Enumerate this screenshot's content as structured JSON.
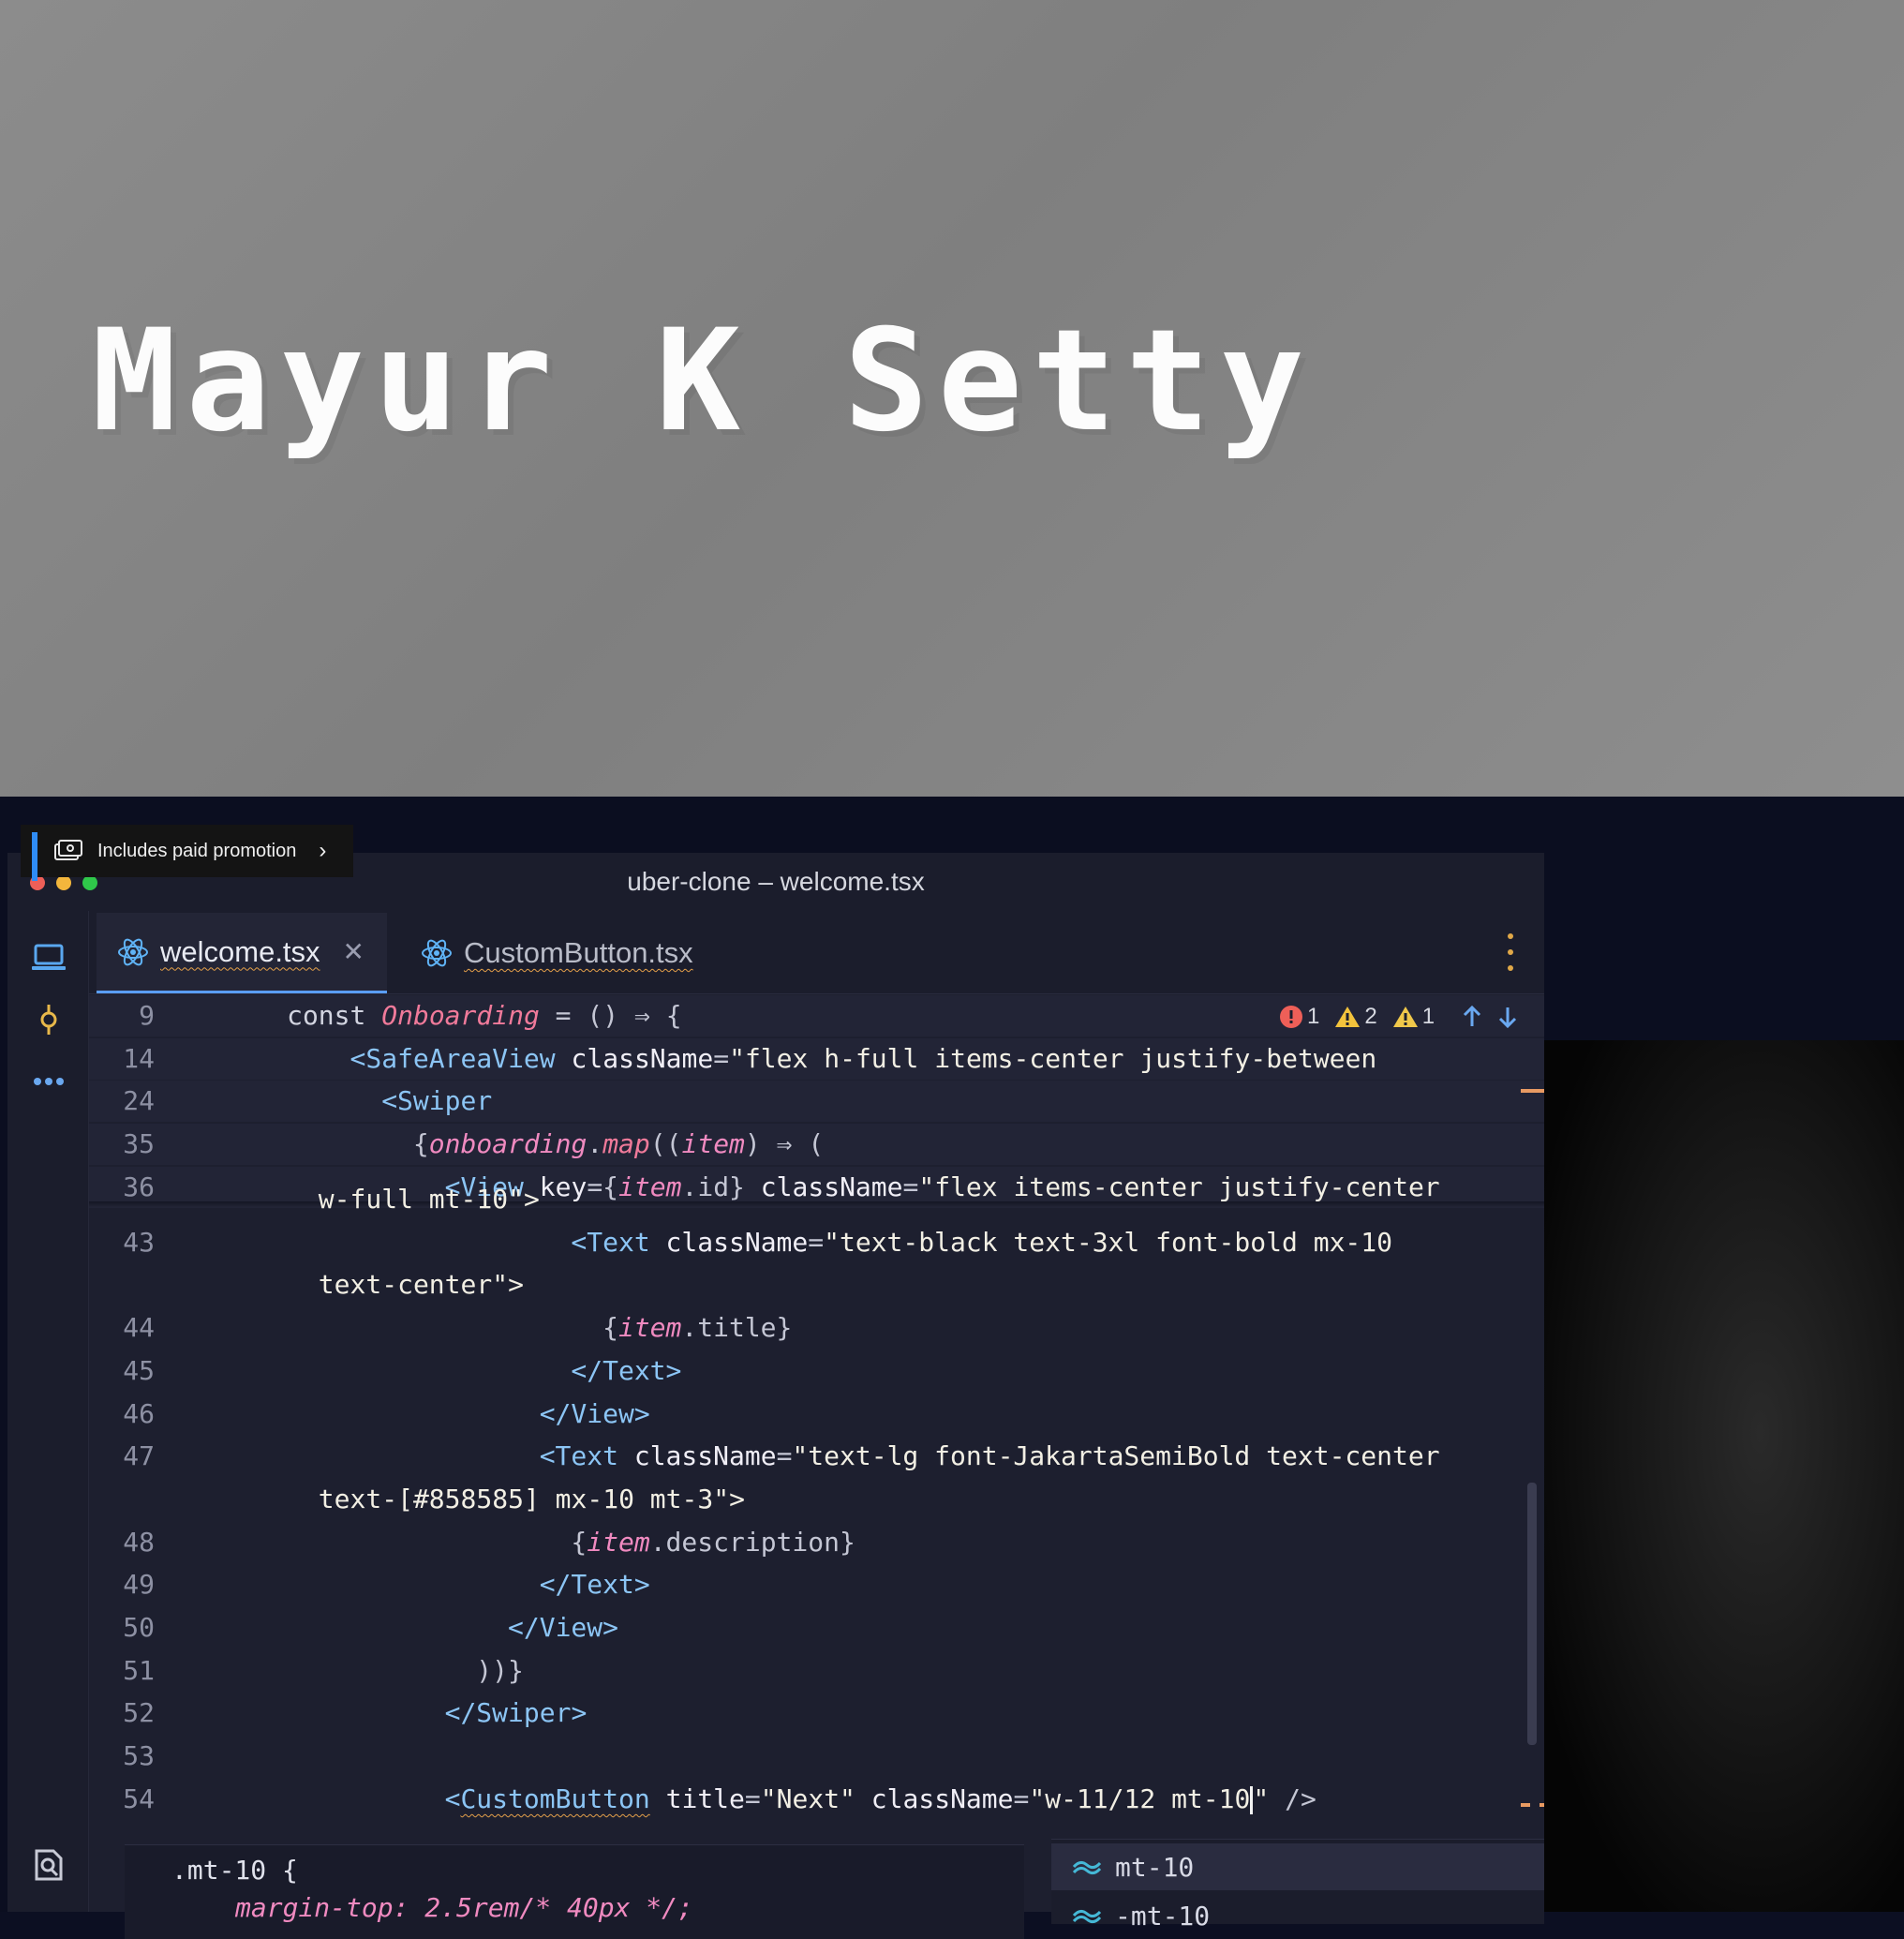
{
  "banner": {
    "title": "Mayur K Setty"
  },
  "promo": {
    "label": "Includes paid promotion"
  },
  "window": {
    "title": "uber-clone – welcome.tsx"
  },
  "tabs": [
    {
      "label": "welcome.tsx",
      "active": true
    },
    {
      "label": "CustomButton.tsx",
      "active": false
    }
  ],
  "status": {
    "errors": "1",
    "warnings": "2",
    "weak_warnings": "1"
  },
  "editor": {
    "sticky": [
      {
        "ln": "9",
        "indent": 3,
        "parts": [
          [
            "kw",
            "const "
          ],
          [
            "fn",
            "Onboarding"
          ],
          [
            "punc",
            " = () ⇒ {"
          ]
        ]
      },
      {
        "ln": "14",
        "indent": 5,
        "parts": [
          [
            "tag",
            "<SafeAreaView"
          ],
          [
            "attr",
            " className"
          ],
          [
            "punc",
            "="
          ],
          [
            "str",
            "\"flex h-full items-center justify-between"
          ]
        ]
      },
      {
        "ln": "24",
        "indent": 6,
        "parts": [
          [
            "tag",
            "<Swiper"
          ]
        ]
      },
      {
        "ln": "35",
        "indent": 7,
        "parts": [
          [
            "punc",
            "{"
          ],
          [
            "var",
            "onboarding"
          ],
          [
            "punc",
            "."
          ],
          [
            "fn",
            "map"
          ],
          [
            "punc",
            "(("
          ],
          [
            "var",
            "item"
          ],
          [
            "punc",
            ") ⇒ ("
          ]
        ]
      },
      {
        "ln": "36",
        "indent": 8,
        "parts": [
          [
            "tag",
            "<View"
          ],
          [
            "attr",
            " key"
          ],
          [
            "punc",
            "={"
          ],
          [
            "var",
            "item"
          ],
          [
            "punc",
            ".id}"
          ],
          [
            "attr",
            " className"
          ],
          [
            "punc",
            "="
          ],
          [
            "str",
            "\"flex items-center justify-center"
          ]
        ]
      }
    ],
    "lines": [
      {
        "ln": "",
        "indent": 4,
        "parts": [
          [
            "str",
            "w-full mt-10\">"
          ]
        ]
      },
      {
        "ln": "43",
        "indent": 12,
        "parts": [
          [
            "tag",
            "<Text"
          ],
          [
            "attr",
            " className"
          ],
          [
            "punc",
            "="
          ],
          [
            "str",
            "\"text-black text-3xl font-bold mx-10"
          ]
        ]
      },
      {
        "ln": "",
        "indent": 4,
        "parts": [
          [
            "str",
            "text-center\">"
          ]
        ]
      },
      {
        "ln": "44",
        "indent": 13,
        "parts": [
          [
            "punc",
            "{"
          ],
          [
            "var",
            "item"
          ],
          [
            "punc",
            ".title}"
          ]
        ]
      },
      {
        "ln": "45",
        "indent": 12,
        "parts": [
          [
            "tag",
            "</Text>"
          ]
        ]
      },
      {
        "ln": "46",
        "indent": 11,
        "parts": [
          [
            "tag",
            "</View>"
          ]
        ]
      },
      {
        "ln": "47",
        "indent": 11,
        "parts": [
          [
            "tag",
            "<Text"
          ],
          [
            "attr",
            " className"
          ],
          [
            "punc",
            "="
          ],
          [
            "str",
            "\"text-lg font-JakartaSemiBold text-center"
          ]
        ]
      },
      {
        "ln": "",
        "indent": 4,
        "parts": [
          [
            "str",
            "text-[#858585] mx-10 mt-3\">"
          ]
        ]
      },
      {
        "ln": "48",
        "indent": 12,
        "parts": [
          [
            "punc",
            "{"
          ],
          [
            "var",
            "item"
          ],
          [
            "punc",
            ".description}"
          ]
        ]
      },
      {
        "ln": "49",
        "indent": 11,
        "parts": [
          [
            "tag",
            "</Text>"
          ]
        ]
      },
      {
        "ln": "50",
        "indent": 10,
        "parts": [
          [
            "tag",
            "</View>"
          ]
        ]
      },
      {
        "ln": "51",
        "indent": 9,
        "parts": [
          [
            "punc",
            "))}"
          ]
        ]
      },
      {
        "ln": "52",
        "indent": 8,
        "parts": [
          [
            "tag",
            "</Swiper>"
          ]
        ]
      },
      {
        "ln": "53",
        "indent": 0,
        "parts": []
      },
      {
        "ln": "54",
        "indent": 8,
        "parts": [
          [
            "tag",
            "<"
          ],
          [
            "tagu",
            "CustomButton"
          ],
          [
            "attr",
            " title"
          ],
          [
            "punc",
            "="
          ],
          [
            "str",
            "\"Next\""
          ],
          [
            "attr",
            " className"
          ],
          [
            "punc",
            "="
          ],
          [
            "str",
            "\"w-11/12 mt-10"
          ],
          [
            "cursor",
            ""
          ],
          [
            "str",
            "\""
          ],
          [
            "punc",
            " />"
          ]
        ]
      }
    ]
  },
  "hover_doc": {
    "line1": ".mt-10 {",
    "line2": "margin-top: 2.5rem/* 40px */;"
  },
  "suggestions": [
    {
      "label": "mt-10"
    },
    {
      "label": "-mt-10"
    }
  ],
  "colors": {
    "accent": "#5a9df7",
    "error": "#ee5f58",
    "warning": "#f3c33c"
  }
}
